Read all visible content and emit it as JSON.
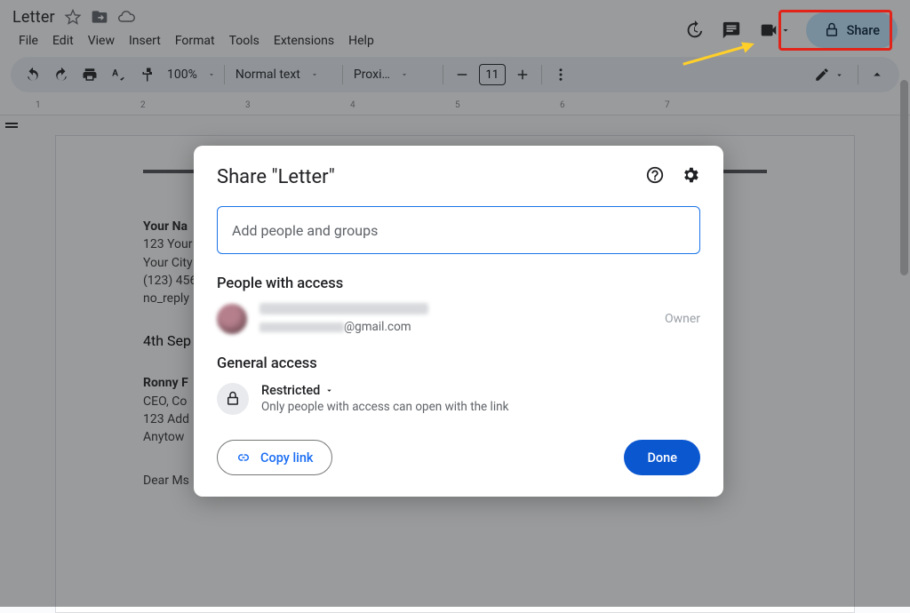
{
  "doc": {
    "title": "Letter"
  },
  "menus": {
    "file": "File",
    "edit": "Edit",
    "view": "View",
    "insert": "Insert",
    "format": "Format",
    "tools": "Tools",
    "extensions": "Extensions",
    "help": "Help"
  },
  "header": {
    "share_label": "Share"
  },
  "toolbar": {
    "zoom": "100%",
    "style": "Normal text",
    "font": "Proxi…",
    "font_size": "11"
  },
  "document": {
    "sender": {
      "name": "Your Na",
      "addr1": "123 Your",
      "addr2": "Your City",
      "phone": "(123) 456",
      "email": "no_reply"
    },
    "date": "4th Sep",
    "recipient": {
      "name": "Ronny F",
      "title": "CEO, Co",
      "addr1": "123 Add",
      "addr2": "Anytow"
    },
    "salutation": "Dear Ms"
  },
  "dialog": {
    "title": "Share \"Letter\"",
    "input_placeholder": "Add people and groups",
    "people_heading": "People with access",
    "owner_email_suffix": "@gmail.com",
    "owner_role": "Owner",
    "general_heading": "General access",
    "general_label": "Restricted",
    "general_desc": "Only people with access can open with the link",
    "copy_label": "Copy link",
    "done_label": "Done"
  },
  "ruler": {
    "marks": [
      "1",
      "2",
      "3",
      "4",
      "5",
      "6",
      "7"
    ]
  }
}
